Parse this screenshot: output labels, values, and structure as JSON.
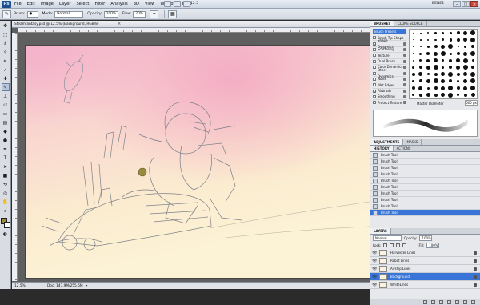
{
  "app": {
    "logo": "Ps"
  },
  "menu": {
    "items": [
      "File",
      "Edit",
      "Image",
      "Layer",
      "Select",
      "Filter",
      "Analysis",
      "3D",
      "View",
      "Window",
      "Help"
    ]
  },
  "menubar": {
    "zoom": "12.5",
    "workspace": "BENE2"
  },
  "options": {
    "brush_label": "Brush:",
    "mode_label": "Mode:",
    "mode_value": "Normal",
    "opacity_label": "Opacity:",
    "opacity_value": "100%",
    "flow_label": "Flow:",
    "flow_value": "20%"
  },
  "tools": [
    "move",
    "marquee",
    "lasso",
    "quick-select",
    "crop",
    "eyedropper",
    "healing",
    "brush",
    "clone-stamp",
    "history-brush",
    "eraser",
    "gradient",
    "blur",
    "dodge",
    "pen",
    "type",
    "path-select",
    "shape",
    "3d-rotate",
    "3d-orbit",
    "hand",
    "zoom"
  ],
  "colors": {
    "foreground": "#9a8a3e",
    "background": "#ffffff",
    "selection": "#3875d7"
  },
  "document": {
    "tab_label": "Steamfantasy.psd @ 12.5% (Background, RGB/8)",
    "status_zoom": "12.5%",
    "status_doc": "Doc: 147.9M/255.6M"
  },
  "brushes": {
    "tabs": [
      "BRUSHES",
      "CLONE SOURCE"
    ],
    "preset_button": "Brush Presets",
    "options": [
      {
        "label": "Brush Tip Shape",
        "checked": false,
        "lock": false
      },
      {
        "label": "Shape Dynamics",
        "checked": true,
        "lock": true
      },
      {
        "label": "Scattering",
        "checked": false,
        "lock": true
      },
      {
        "label": "Texture",
        "checked": false,
        "lock": true
      },
      {
        "label": "Dual Brush",
        "checked": false,
        "lock": true
      },
      {
        "label": "Color Dynamics",
        "checked": false,
        "lock": true
      },
      {
        "label": "Other Dynamics",
        "checked": false,
        "lock": true
      },
      {
        "label": "Noise",
        "checked": false,
        "lock": true
      },
      {
        "label": "Wet Edges",
        "checked": false,
        "lock": true
      },
      {
        "label": "Airbrush",
        "checked": true,
        "lock": true
      },
      {
        "label": "Smoothing",
        "checked": true,
        "lock": true
      },
      {
        "label": "Protect Texture",
        "checked": false,
        "lock": true
      }
    ],
    "master_label": "Master Diameter",
    "master_value": "600 px"
  },
  "history": {
    "tabs": [
      "ADJUSTMENTS",
      "MASKS"
    ],
    "sub_tabs": [
      "HISTORY",
      "ACTIONS"
    ],
    "items": [
      "Brush Tool",
      "Brush Tool",
      "Brush Tool",
      "Brush Tool",
      "Brush Tool",
      "Brush Tool",
      "Brush Tool",
      "Brush Tool",
      "Brush Tool",
      "Brush Tool"
    ],
    "selected_index": 9
  },
  "layers": {
    "tabs": [
      "LAYERS"
    ],
    "blend_mode": "Normal",
    "opacity_label": "Opacity:",
    "opacity_value": "100%",
    "lock_label": "Lock:",
    "fill_label": "Fill:",
    "fill_value": "100%",
    "items": [
      {
        "name": "Harvester Lines",
        "locked": true
      },
      {
        "name": "Robot Lines",
        "locked": true
      },
      {
        "name": "Airship Lines",
        "locked": true
      },
      {
        "name": "Background",
        "locked": true
      },
      {
        "name": "WhiteLines",
        "locked": true
      }
    ],
    "selected_index": 3
  }
}
